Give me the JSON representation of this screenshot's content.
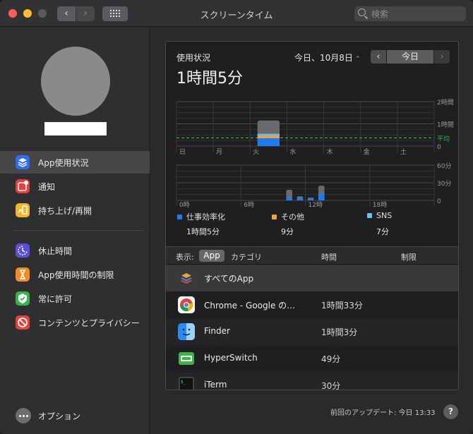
{
  "window": {
    "title": "スクリーンタイム",
    "search_placeholder": "検索",
    "back_glyph": "‹",
    "forward_glyph": "›"
  },
  "sidebar": {
    "items": [
      {
        "label": "App使用状況",
        "icon": "layers-icon",
        "color": "#2d6cf5",
        "selected": true
      },
      {
        "label": "通知",
        "icon": "notification-icon",
        "color": "#e8403a",
        "selected": false
      },
      {
        "label": "持ち上げ/再開",
        "icon": "pickup-icon",
        "color": "#f3b62b",
        "selected": false
      },
      {
        "label": "休止時間",
        "icon": "downtime-icon",
        "color": "#5a4fd6",
        "selected": false
      },
      {
        "label": "App使用時間の制限",
        "icon": "hourglass-icon",
        "color": "#f08a2a",
        "selected": false
      },
      {
        "label": "常に許可",
        "icon": "checkmark-shield-icon",
        "color": "#35b54a",
        "selected": false
      },
      {
        "label": "コンテンツとプライバシー",
        "icon": "restriction-icon",
        "color": "#e8403a",
        "selected": false
      }
    ],
    "options_label": "オプション"
  },
  "usage": {
    "title": "使用状況",
    "total": "1時間5分",
    "date": "今日、10月8日",
    "date_chevron": "⌃",
    "prev_glyph": "‹",
    "today_label": "今日",
    "next_glyph": "›"
  },
  "weekly_chart": {
    "days": [
      "日",
      "月",
      "火",
      "水",
      "木",
      "金",
      "土"
    ],
    "y_ticks": [
      "2時間",
      "1時間",
      "0"
    ],
    "average_label": "平均",
    "average_hours": 0.37,
    "bars": [
      {
        "day": "火",
        "work_hours": 0.35,
        "other_hours": 0.12,
        "sns_hours": 0.08,
        "total_hours": 1.15
      }
    ]
  },
  "hourly_chart": {
    "x_ticks": [
      "0時",
      "6時",
      "12時",
      "18時"
    ],
    "y_ticks": [
      "60分",
      "30分",
      "0"
    ],
    "bars": [
      {
        "hour": 10,
        "work": 5,
        "total": 18
      },
      {
        "hour": 11,
        "work": 4,
        "total": 7
      },
      {
        "hour": 12,
        "work": 3,
        "total": 5
      },
      {
        "hour": 13,
        "work": 12,
        "total": 25
      }
    ]
  },
  "legend": [
    {
      "label": "仕事効率化",
      "value": "1時間5分",
      "color": "#1e7cf2"
    },
    {
      "label": "その他",
      "value": "9分",
      "color": "#f2a23a"
    },
    {
      "label": "SNS",
      "value": "7分",
      "color": "#63c7f5"
    }
  ],
  "table": {
    "show_label": "表示:",
    "seg_app": "App",
    "seg_category": "カテゴリ",
    "col_time": "時間",
    "col_limit": "制限",
    "rows": [
      {
        "name": "すべてのApp",
        "time": "",
        "icon": "stack-icon"
      },
      {
        "name": "Chrome - Google の…",
        "time": "1時間33分",
        "icon": "chrome-icon"
      },
      {
        "name": "Finder",
        "time": "1時間3分",
        "icon": "finder-icon"
      },
      {
        "name": "HyperSwitch",
        "time": "49分",
        "icon": "hyperswitch-icon"
      },
      {
        "name": "iTerm",
        "time": "30分",
        "icon": "terminal-icon"
      }
    ]
  },
  "footer": {
    "last_update": "前回のアップデート: 今日 13:33",
    "help": "?"
  }
}
